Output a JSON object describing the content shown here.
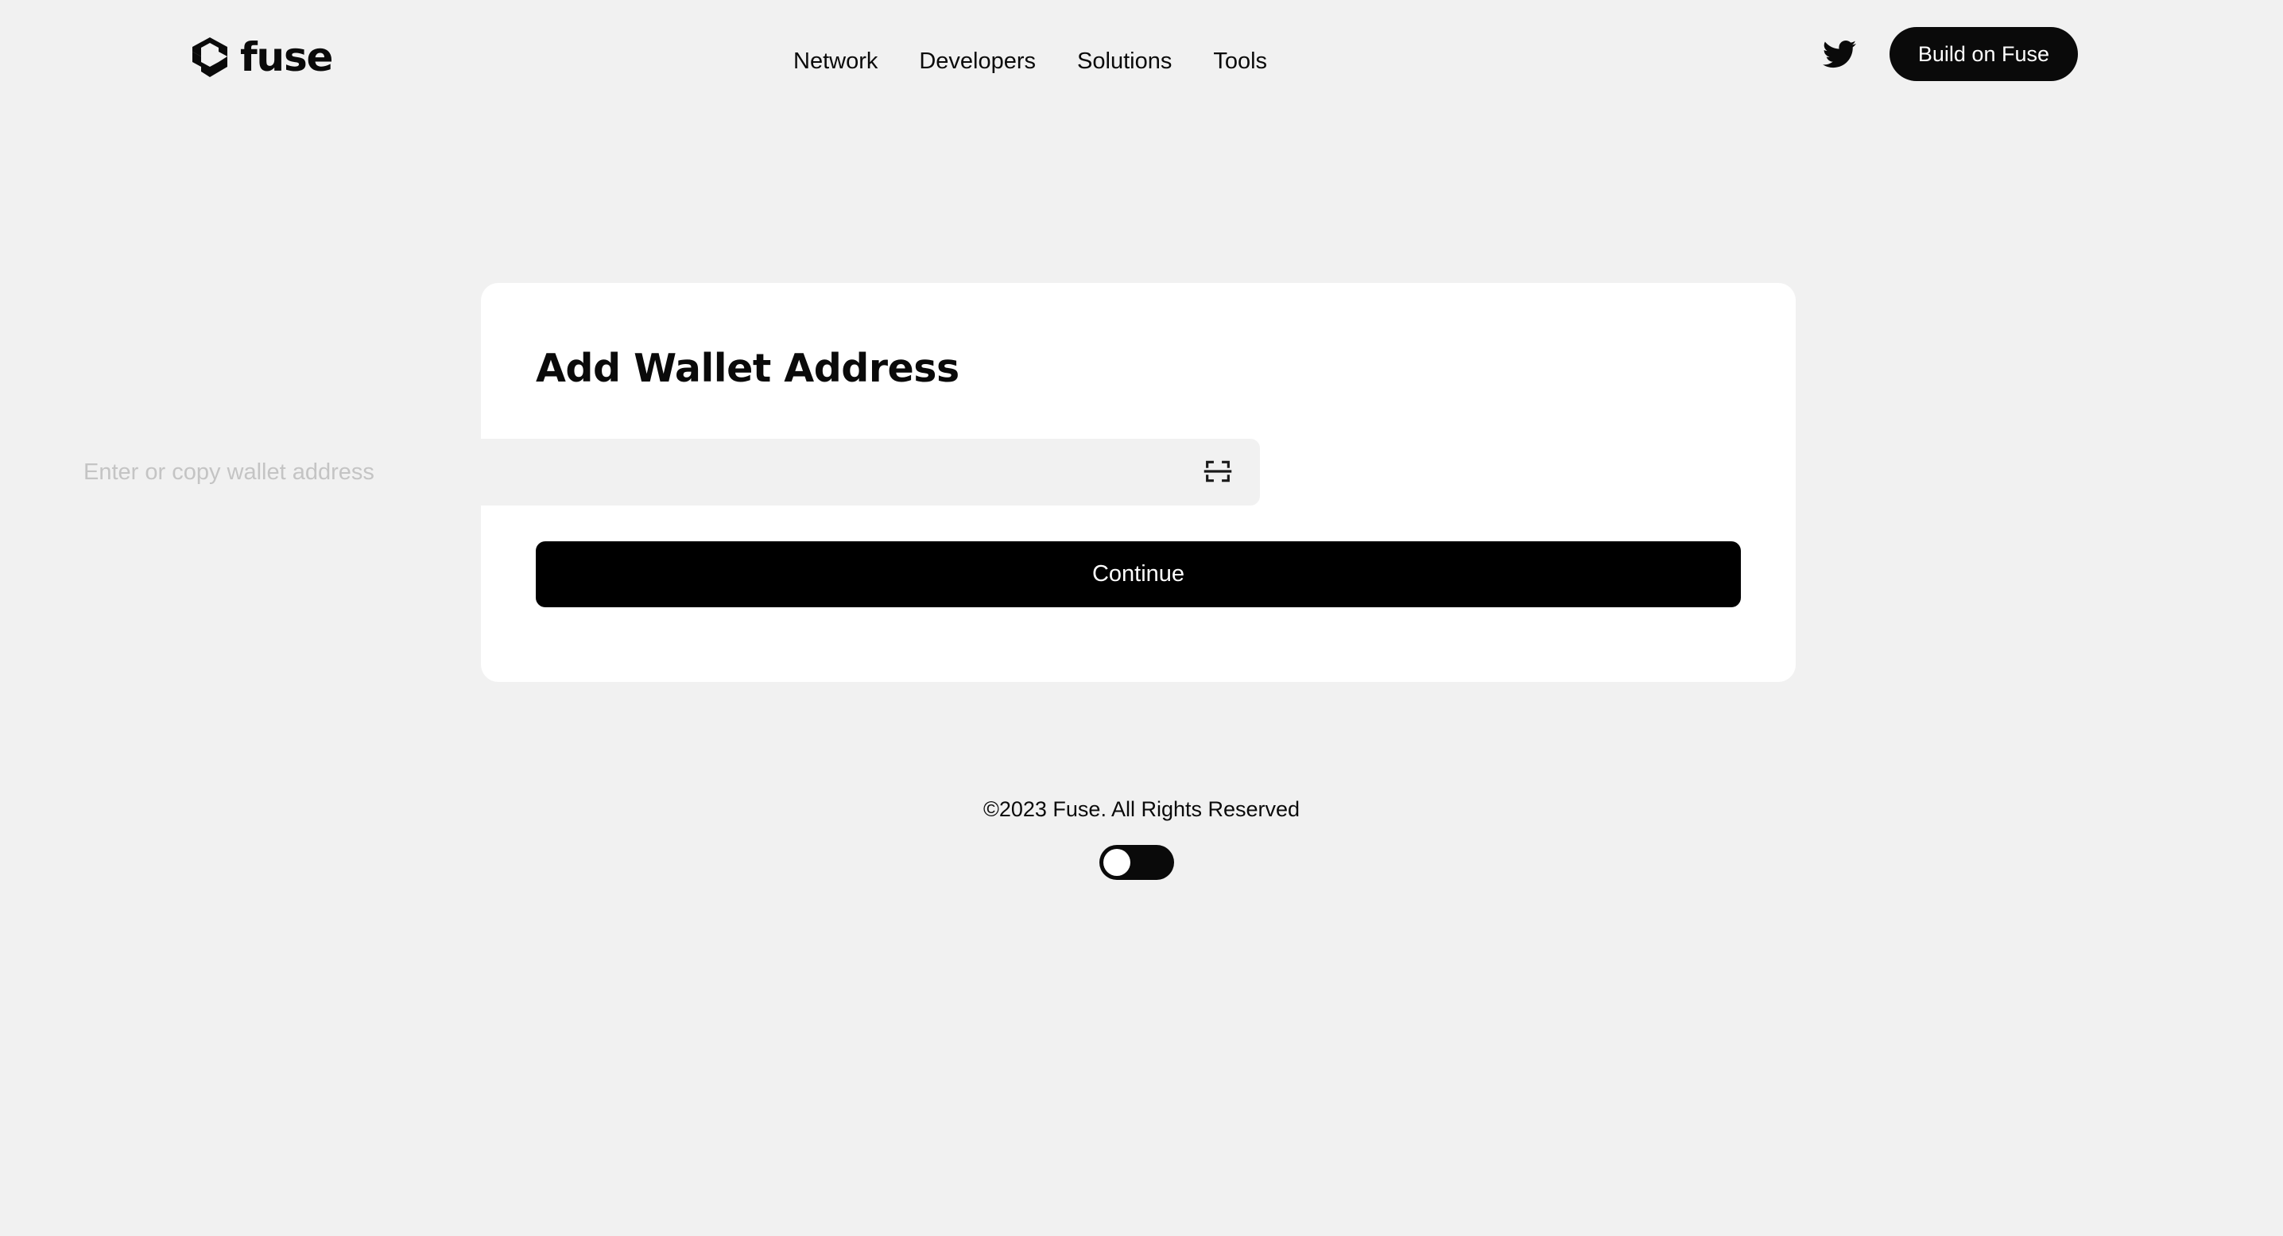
{
  "theme": {
    "page_background": "#F1F1F1",
    "card_background": "#FFFFFF",
    "accent": "#0A0A0A",
    "input_background": "#F1F1F1",
    "placeholder_color": "#C4C4C4",
    "button_text": "#FFFFFF"
  },
  "header": {
    "logo": {
      "wordmark": "fuse",
      "mark_icon": "fuse-hexagon-icon"
    },
    "nav": [
      {
        "label": "Network"
      },
      {
        "label": "Developers"
      },
      {
        "label": "Solutions"
      },
      {
        "label": "Tools"
      }
    ],
    "social": {
      "twitter_icon": "twitter-bird-icon"
    },
    "cta": {
      "label": "Build on Fuse"
    }
  },
  "main": {
    "card": {
      "title": "Add Wallet Address",
      "input": {
        "placeholder": "Enter or copy wallet address",
        "value": "",
        "scan_icon": "qr-scan-icon"
      },
      "submit": {
        "label": "Continue"
      }
    }
  },
  "footer": {
    "copyright": "©2023 Fuse. All Rights Reserved",
    "theme_toggle": {
      "state": "off",
      "icon": "toggle-switch-icon"
    }
  }
}
